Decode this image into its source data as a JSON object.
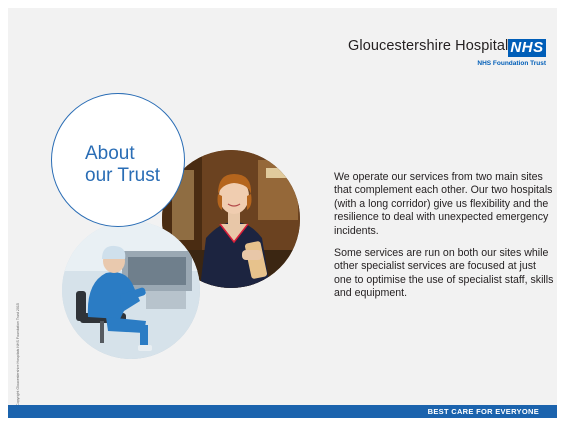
{
  "header": {
    "organization": "Gloucestershire Hospitals",
    "nhs_logo": "NHS",
    "subtitle": "NHS Foundation Trust"
  },
  "heading": {
    "line1": "About",
    "line2": "our Trust"
  },
  "body": {
    "paragraph1": "We operate our services from two main sites that complement each other. Our two hospitals (with a long corridor) give us flexibility and the resilience to deal with unexpected emergency incidents.",
    "paragraph2": "Some services are run on both our sites while other specialist services are focused at just one to optimise the use of specialist staff, skills and equipment."
  },
  "images": {
    "nurse_photo": "nurse-photo",
    "surgeon_photo": "surgeon-photo"
  },
  "copyright": "Copyright Gloucestershire Hospitals NHS Foundation Trust 2015",
  "footer": {
    "tagline": "BEST CARE FOR EVERYONE"
  },
  "colors": {
    "nhs_blue": "#005eb8",
    "heading_blue": "#2a6db5",
    "footer_blue": "#1b63ad",
    "background": "#f2f2f2"
  }
}
